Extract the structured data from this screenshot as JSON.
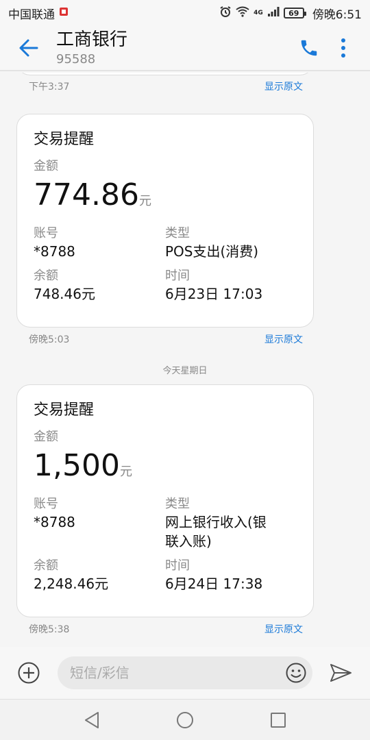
{
  "status_bar": {
    "carrier": "中国联通",
    "network": "4G",
    "battery": "69",
    "time": "傍晚6:51"
  },
  "header": {
    "title": "工商银行",
    "subtitle": "95588"
  },
  "messages": [
    {
      "time": "下午3:37",
      "show_original": "显示原文"
    },
    {
      "card_title": "交易提醒",
      "amount_label": "金额",
      "amount": "774.86",
      "amount_unit": "元",
      "account_label": "账号",
      "account": "*8788",
      "type_label": "类型",
      "type": "POS支出(消费)",
      "balance_label": "余额",
      "balance": "748.46元",
      "time_label": "时间",
      "txn_time": "6月23日 17:03",
      "time": "傍晚5:03",
      "show_original": "显示原文"
    },
    {
      "card_title": "交易提醒",
      "amount_label": "金额",
      "amount": "1,500",
      "amount_unit": "元",
      "account_label": "账号",
      "account": "*8788",
      "type_label": "类型",
      "type_line1": "网上银行收入(银",
      "type_line2": "联入账)",
      "balance_label": "余额",
      "balance": "2,248.46元",
      "time_label": "时间",
      "txn_time": "6月24日 17:38",
      "time": "傍晚5:38",
      "show_original": "显示原文"
    }
  ],
  "date_separator": "今天星期日",
  "input": {
    "placeholder": "短信/彩信"
  },
  "colors": {
    "accent": "#1a79d8",
    "link": "#1a79d8"
  },
  "icons": {
    "back": "arrow-left-icon",
    "call": "phone-icon",
    "more": "more-vert-icon",
    "add": "plus-circle-icon",
    "emoji": "smiley-icon",
    "send": "send-icon"
  }
}
